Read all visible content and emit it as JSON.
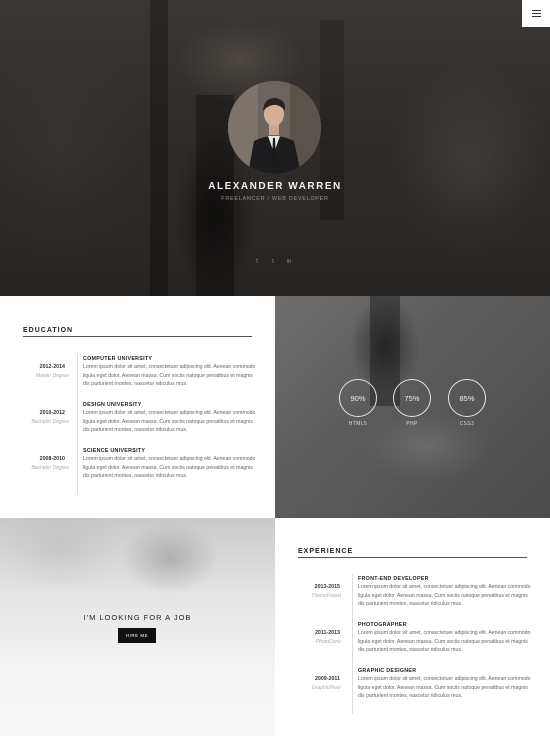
{
  "menu": {
    "icon": "hamburger-icon"
  },
  "hero": {
    "name": "ALEXANDER WARREN",
    "subtitle": "FREELANCER / WEB DEVELOPER",
    "socials": [
      "f",
      "t",
      "in"
    ]
  },
  "education": {
    "title": "EDUCATION",
    "items": [
      {
        "years": "2012-2014",
        "degree": "Master Degree",
        "title": "COMPUTER UNIVERSITY",
        "text": "Lorem ipsum dolor sit amet, consectetuer adipiscing elit. Aenean commodo ligula eget dolor. Aenean massa. Cum sociis natoque penatibus et magnis dis parturient montes, nascetur ridiculus mus."
      },
      {
        "years": "2010-2012",
        "degree": "Bachelor Degree",
        "title": "DESIGN UNIVERSITY",
        "text": "Lorem ipsum dolor sit amet, consectetuer adipiscing elit. Aenean commodo ligula eget dolor. Aenean massa. Cum sociis natoque penatibus et magnis dis parturient montes, nascetur ridiculus mus."
      },
      {
        "years": "2008-2010",
        "degree": "Bachelor Degree",
        "title": "SCIENCE UNIVERSITY",
        "text": "Lorem ipsum dolor sit amet, consectetuer adipiscing elit. Aenean commodo ligula eget dolor. Aenean massa. Cum sociis natoque penatibus et magnis dis parturient montes, nascetur ridiculus mus."
      }
    ]
  },
  "skills": [
    {
      "value": "90%",
      "label": "HTML5"
    },
    {
      "value": "75%",
      "label": "PHP"
    },
    {
      "value": "85%",
      "label": "CSS3"
    }
  ],
  "job": {
    "title": "I'M LOOKING FOR A JOB",
    "button": "HIRE ME"
  },
  "experience": {
    "title": "EXPERIENCE",
    "items": [
      {
        "years": "2013-2015",
        "company": "ThemeForest",
        "title": "FRONT-END DEVELOPER",
        "text": "Lorem ipsum dolor sit amet, consectetuer adipiscing elit. Aenean commodo ligula eget dolor. Aenean massa. Cum sociis natoque penatibus et magnis dis parturient montes, nascetur ridiculus mus."
      },
      {
        "years": "2011-2013",
        "company": "PhotoDune",
        "title": "PHOTOGRAPHER",
        "text": "Lorem ipsum dolor sit amet, consectetuer adipiscing elit. Aenean commodo ligula eget dolor. Aenean massa. Cum sociis natoque penatibus et magnis dis parturient montes, nascetur ridiculus mus."
      },
      {
        "years": "2009-2011",
        "company": "GraphicRiver",
        "title": "GRAPHIC DESIGNER",
        "text": "Lorem ipsum dolor sit amet, consectetuer adipiscing elit. Aenean commodo ligula eget dolor. Aenean massa. Cum sociis natoque penatibus et magnis dis parturient montes, nascetur ridiculus mus."
      }
    ]
  }
}
